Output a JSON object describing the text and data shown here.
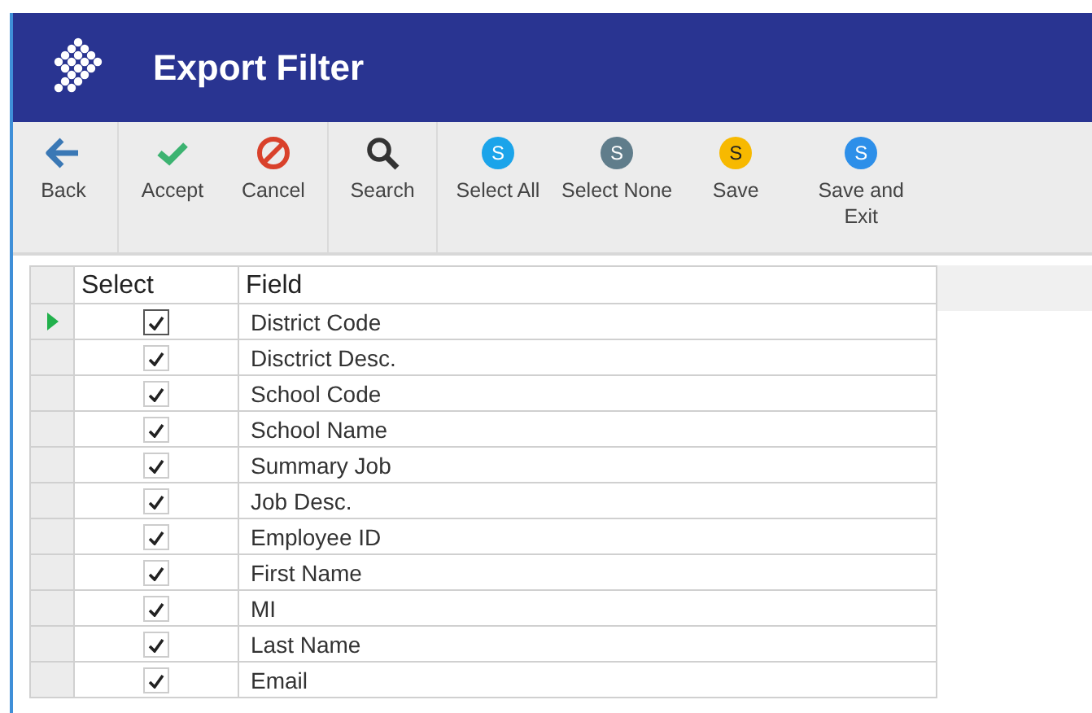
{
  "window": {
    "title": "Export Filter"
  },
  "toolbar": [
    {
      "kind": "back",
      "label": "Back"
    },
    {
      "kind": "separator"
    },
    {
      "kind": "accept",
      "label": "Accept"
    },
    {
      "kind": "cancel",
      "label": "Cancel"
    },
    {
      "kind": "separator"
    },
    {
      "kind": "search",
      "label": "Search"
    },
    {
      "kind": "separator"
    },
    {
      "kind": "badge",
      "label": "Select All",
      "badge": "S",
      "color": "#1ba4ea"
    },
    {
      "kind": "badge",
      "label": "Select None",
      "badge": "S",
      "color": "#607d8b"
    },
    {
      "kind": "badge",
      "label": "Save",
      "badge": "S",
      "color": "#f7b900"
    },
    {
      "kind": "badge",
      "label": "Save and Exit",
      "badge": "S",
      "color": "#2d8fe9"
    }
  ],
  "table": {
    "columns": [
      "Select",
      "Field"
    ],
    "rows": [
      {
        "field": "District Code",
        "checked": true,
        "selected": true
      },
      {
        "field": "Disctrict Desc.",
        "checked": true,
        "selected": false
      },
      {
        "field": "School Code",
        "checked": true,
        "selected": false
      },
      {
        "field": "School Name",
        "checked": true,
        "selected": false
      },
      {
        "field": "Summary Job",
        "checked": true,
        "selected": false
      },
      {
        "field": "Job Desc.",
        "checked": true,
        "selected": false
      },
      {
        "field": "Employee ID",
        "checked": true,
        "selected": false
      },
      {
        "field": "First Name",
        "checked": true,
        "selected": false
      },
      {
        "field": "MI",
        "checked": true,
        "selected": false
      },
      {
        "field": "Last Name",
        "checked": true,
        "selected": false
      },
      {
        "field": "Email",
        "checked": true,
        "selected": false
      }
    ]
  }
}
